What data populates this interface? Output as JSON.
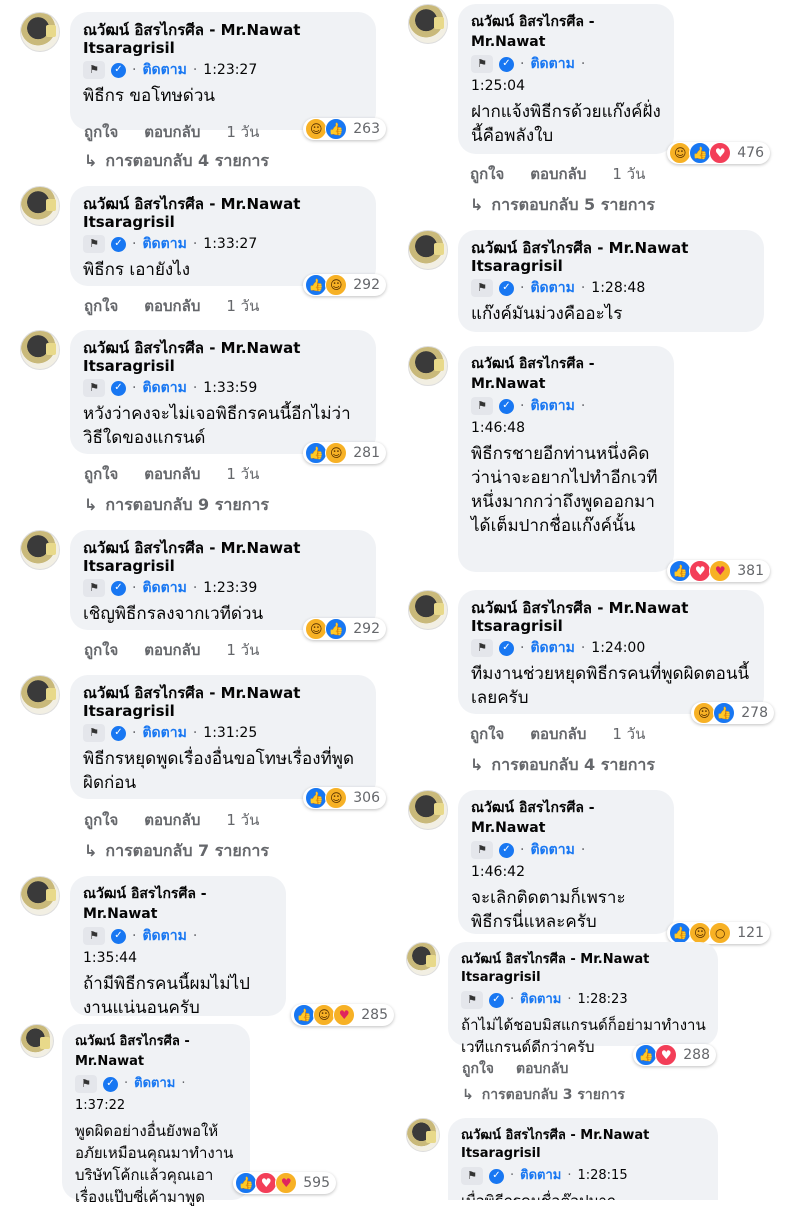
{
  "author": {
    "name_line1": "ณวัฒน์ อิสรไกรศีล - Mr.Nawat",
    "name_line2": "Itsaragrisil",
    "follow": "ติดตาม"
  },
  "actions": {
    "like": "ถูกใจ",
    "reply": "ตอบกลับ",
    "age": "1 วัน"
  },
  "icons": {
    "flag": "flag-icon",
    "verified": "verified-badge-icon",
    "reply_arrow": "reply-arrow-icon"
  },
  "comments": [
    {
      "time": "1:23:27",
      "text": "พิธีกร ขอโทษด่วน",
      "reactions": [
        "haha",
        "like"
      ],
      "count": "263",
      "replies": "การตอบกลับ 4 รายการ"
    },
    {
      "time": "1:33:27",
      "text": "พิธีกร เอายังไง",
      "reactions": [
        "like",
        "haha"
      ],
      "count": "292",
      "replies": ""
    },
    {
      "time": "1:33:59",
      "text": "หวังว่าคงจะไม่เจอพิธีกรคนนี้อีกไม่ว่าวิธีใดของแกรนด์",
      "reactions": [
        "like",
        "haha"
      ],
      "count": "281",
      "replies": "การตอบกลับ 9 รายการ"
    },
    {
      "time": "1:23:39",
      "text": "เชิญพิธีกรลงจากเวทีด่วน",
      "reactions": [
        "haha",
        "like"
      ],
      "count": "292",
      "replies": ""
    },
    {
      "time": "1:31:25",
      "text": "พิธีกรหยุดพูดเรื่องอื่นขอโทษเรื่องที่พูดผิดก่อน",
      "reactions": [
        "like",
        "haha"
      ],
      "count": "306",
      "replies": "การตอบกลับ 7 รายการ"
    },
    {
      "time": "1:35:44",
      "text": "ถ้ามีพิธีกรคนนี้ผมไม่ไปงานแน่นอนครับ",
      "reactions": [
        "like",
        "haha",
        "care"
      ],
      "count": "285",
      "replies": ""
    },
    {
      "time": "1:37:22",
      "text": "พูดผิดอย่างอื่นยังพอให้อภัยเหมือนคุณมาทำงานบริษัทโค้กแล้วคุณเอาเรื่องแป๊บซี่เค้ามาพูด",
      "reactions": [
        "like",
        "love",
        "care"
      ],
      "count": "595",
      "replies": ""
    },
    {
      "time": "1:25:04",
      "text": "ฝากแจ้งพิธีกรด้วยแก๊งค์ฝั่งนี้คือพลังใบ",
      "reactions": [
        "haha",
        "like",
        "love"
      ],
      "count": "476",
      "replies": "การตอบกลับ 5 รายการ"
    },
    {
      "time": "1:28:48",
      "text": "แก๊งค์มันม่วงคืออะไร",
      "reactions": [
        "haha",
        "like"
      ],
      "count": "",
      "replies": ""
    },
    {
      "time": "1:46:48",
      "text": "พิธีกรชายอีกท่านหนึ่งคิดว่าน่าจะอยากไปทำอีกเวทีหนึ่งมากกว่าถึงพูดออกมาได้เต็มปากชื่อแก๊งค์นั้น",
      "reactions": [
        "like",
        "love",
        "care"
      ],
      "count": "381",
      "replies": ""
    },
    {
      "time": "1:24:00",
      "text": "ทีมงานช่วยหยุดพิธีกรคนที่พูดผิดตอนนี้เลยครับ",
      "reactions": [
        "haha",
        "like"
      ],
      "count": "278",
      "replies": "การตอบกลับ 4 รายการ"
    },
    {
      "time": "1:46:42",
      "text": "จะเลิกติดตามก็เพราะพิธีกรนี่แหละครับ",
      "reactions": [
        "like",
        "haha",
        "wow"
      ],
      "count": "121",
      "replies": ""
    },
    {
      "time": "1:28:23",
      "text": "ถ้าไม่ได้ชอบมิสแกรนด์ก็อย่ามาทำงานเวทีแกรนด์ดีกว่าครับ",
      "reactions": [
        "like",
        "love"
      ],
      "count": "288",
      "replies": "การตอบกลับ 3 รายการ"
    },
    {
      "time": "1:28:15",
      "text": "เบื่อพิธีกรคนชื่อต๊อปมาก",
      "reactions": [],
      "count": "",
      "replies": ""
    }
  ]
}
